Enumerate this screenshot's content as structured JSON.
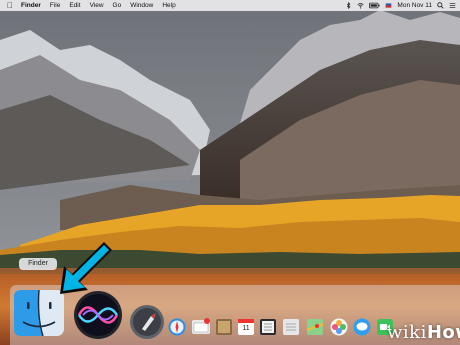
{
  "menubar": {
    "apple_icon": "apple-logo-icon",
    "app_name": "Finder",
    "items": [
      "File",
      "Edit",
      "View",
      "Go",
      "Window",
      "Help"
    ],
    "datetime": "Mon Nov 11",
    "status_icons": [
      "bluetooth-icon",
      "wifi-icon",
      "battery-icon",
      "flag-icon",
      "search-icon",
      "list-icon"
    ]
  },
  "tooltip": {
    "label": "Finder"
  },
  "dock": {
    "items": [
      {
        "name": "finder",
        "icon": "finder-icon"
      },
      {
        "name": "siri",
        "icon": "siri-icon"
      },
      {
        "name": "launchpad",
        "icon": "launchpad-icon"
      },
      {
        "name": "safari",
        "icon": "safari-icon"
      },
      {
        "name": "mail",
        "icon": "mail-icon"
      },
      {
        "name": "notes",
        "icon": "notes-icon"
      },
      {
        "name": "calendar",
        "icon": "calendar-icon",
        "badge": "11"
      },
      {
        "name": "reminders",
        "icon": "reminders-icon"
      },
      {
        "name": "maps",
        "icon": "maps-icon"
      },
      {
        "name": "photos",
        "icon": "photos-icon"
      },
      {
        "name": "messages",
        "icon": "messages-icon"
      },
      {
        "name": "facetime",
        "icon": "facetime-icon"
      }
    ]
  },
  "watermark": {
    "prefix": "wiki",
    "suffix": "How"
  },
  "colors": {
    "arrow": "#00b4e6",
    "autumn_foliage": "#e8a020",
    "lake": "#c85a20"
  }
}
